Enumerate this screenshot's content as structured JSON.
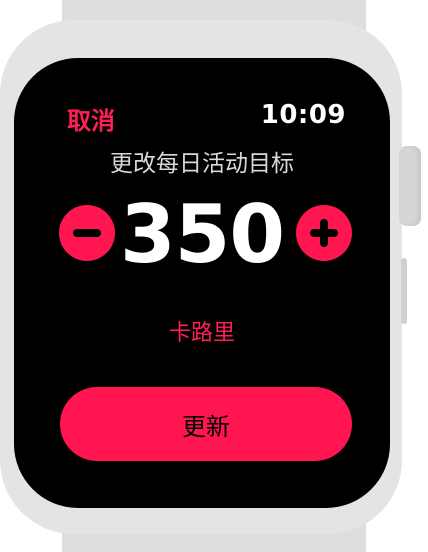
{
  "header": {
    "cancel_label": "取消",
    "time": "10:09"
  },
  "goal": {
    "title": "更改每日活动目标",
    "value": "350",
    "unit": "卡路里"
  },
  "actions": {
    "update_label": "更新"
  },
  "colors": {
    "accent": "#ff1550",
    "screen_background": "#000000",
    "case": "#e4e4e4"
  },
  "icons": {
    "decrease": "minus-icon",
    "increase": "plus-icon"
  }
}
